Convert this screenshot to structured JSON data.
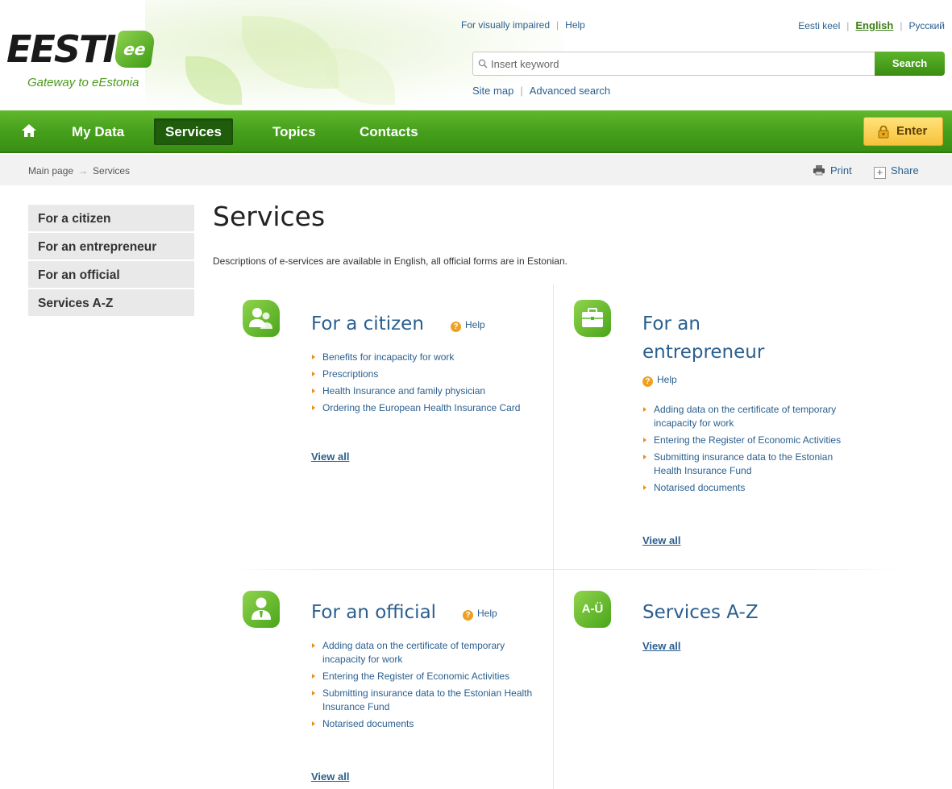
{
  "header": {
    "logo_word": "EESTI",
    "logo_badge": "ee",
    "tagline": "Gateway to eEstonia",
    "links": {
      "visually_impaired": "For visually impaired",
      "help": "Help"
    },
    "languages": [
      "Eesti keel",
      "English",
      "Русский"
    ],
    "search": {
      "placeholder": "Insert keyword",
      "button": "Search"
    },
    "sub_links": {
      "site_map": "Site map",
      "advanced_search": "Advanced search"
    }
  },
  "nav": {
    "items": [
      "My Data",
      "Services",
      "Topics",
      "Contacts"
    ],
    "active": "Services",
    "enter": "Enter"
  },
  "breadcrumb": {
    "items": [
      "Main page",
      "Services"
    ],
    "separator": "→",
    "print": "Print",
    "share": "Share"
  },
  "sidebar": {
    "items": [
      "For a citizen",
      "For an entrepreneur",
      "For an official",
      "Services A-Z"
    ]
  },
  "main": {
    "title": "Services",
    "intro": "Descriptions of e-services are available in English, all official forms are in Estonian.",
    "categories": [
      {
        "title": "For a citizen",
        "help": "Help",
        "items": [
          "Benefits for incapacity for work",
          "Prescriptions",
          "Health Insurance and family physician",
          "Ordering the European Health Insurance Card"
        ],
        "view_all": "View all"
      },
      {
        "title_line1": "For an",
        "title_line2": "entrepreneur",
        "help": "Help",
        "items": [
          "Adding data on the certificate of temporary incapacity for work",
          "Entering the Register of Economic Activities",
          "Submitting insurance data to the Estonian Health Insurance Fund",
          "Notarised documents"
        ],
        "view_all": "View all"
      },
      {
        "title": "For an official",
        "help": "Help",
        "items": [
          "Adding data on the certificate of temporary incapacity for work",
          "Entering the Register of Economic Activities",
          "Submitting insurance data to the Estonian Health Insurance Fund",
          "Notarised documents"
        ],
        "view_all": "View all"
      },
      {
        "title": "Services A-Z",
        "icon_text": "A-Ü",
        "view_all": "View all"
      }
    ]
  },
  "colors": {
    "brand_green": "#46a01c",
    "link_blue": "#2a5f8f",
    "accent_orange": "#f08a1a",
    "enter_yellow": "#f6c23b"
  }
}
